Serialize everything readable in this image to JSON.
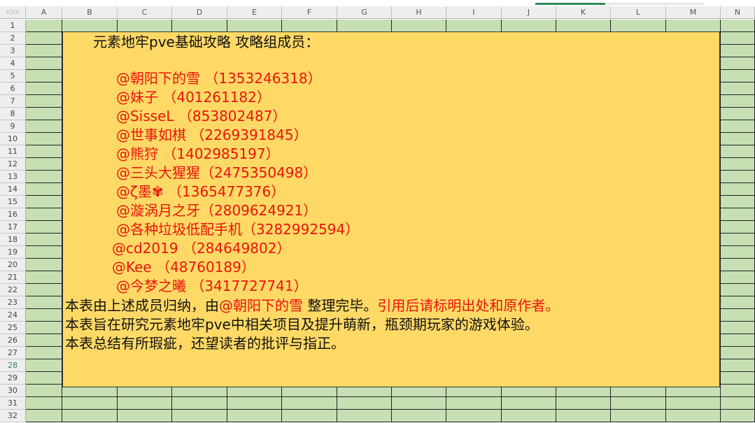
{
  "sheet": {
    "corner_label": "xlsx",
    "columns": [
      "A",
      "B",
      "C",
      "D",
      "E",
      "F",
      "G",
      "H",
      "I",
      "J",
      "K",
      "L",
      "M",
      "N"
    ],
    "rows": [
      "1",
      "2",
      "3",
      "4",
      "5",
      "6",
      "7",
      "8",
      "9",
      "10",
      "11",
      "12",
      "13",
      "14",
      "15",
      "16",
      "17",
      "18",
      "19",
      "20",
      "21",
      "22",
      "23",
      "24",
      "25",
      "26",
      "27",
      "28",
      "29",
      "30",
      "31",
      "32"
    ],
    "active_row": "28"
  },
  "content": {
    "title": "元素地牢pve基础攻略 攻略组成员：",
    "members": [
      "@朝阳下的雪 （1353246318）",
      "@妹子        （401261182）",
      "@SisseL      （853802487）",
      "@世事如棋  （2269391845）",
      "@熊狩        （1402985197）",
      "@三头大猩猩（2475350498）",
      "@ζ墨✾      （1365477376）",
      "@漩涡月之牙（2809624921）",
      "@各种垃圾低配手机（3282992594）",
      "@cd2019      （284649802）",
      "@Kee        （48760189）",
      "@今梦之曦  （3417727741）"
    ],
    "line1_a": "本表由上述成员归纳，由",
    "line1_b": "@朝阳下的雪",
    "line1_c": " 整理完毕。",
    "line1_d": "引用后请标明出处和原作者。",
    "line2": "本表旨在研究元素地牢pve中相关项目及提升萌新，瓶颈期玩家的游戏体验。",
    "line3": "本表总结有所瑕疵，还望读者的批评与指正。"
  },
  "colors": {
    "cell_green": "#c6e0b4",
    "merged_yellow": "#ffd966",
    "text_red": "#e8140c",
    "text_black": "#111111",
    "active_row_green": "#2e8b57"
  }
}
